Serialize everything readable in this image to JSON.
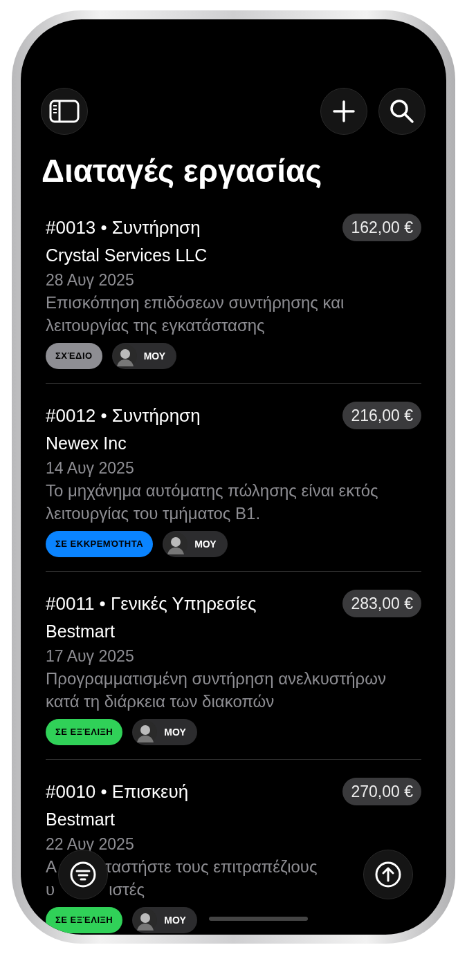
{
  "title": "Διαταγές εργασίας",
  "orders": [
    {
      "heading": "#0013 • Συντήρηση",
      "amount": "162,00 €",
      "customer": "Crystal Services LLC",
      "date": "28 Αυγ 2025",
      "description": "Επισκόπηση επιδόσεων συντήρησης και λειτουργίας της εγκατάστασης",
      "status": {
        "label": "ΣΧΈΔΙΟ",
        "color": "#8e8e93"
      },
      "assignee": "ΜΟΥ"
    },
    {
      "heading": "#0012 • Συντήρηση",
      "amount": "216,00 €",
      "customer": "Newex Inc",
      "date": "14 Αυγ 2025",
      "description": "Το μηχάνημα αυτόματης πώλησης είναι εκτός λειτουργίας του τμήματος Β1.",
      "status": {
        "label": "ΣΕ ΕΚΚΡΕΜΌΤΗΤΑ",
        "color": "#0a84ff"
      },
      "assignee": "ΜΟΥ"
    },
    {
      "heading": "#0011 • Γενικές Υπηρεσίες",
      "amount": "283,00 €",
      "customer": "Bestmart",
      "date": "17 Αυγ 2025",
      "description": "Προγραμματισμένη συντήρηση ανελκυστήρων κατά τη διάρκεια των διακοπών",
      "status": {
        "label": "ΣΕ ΕΞΈΛΙΞΗ",
        "color": "#30d158"
      },
      "assignee": "ΜΟΥ"
    },
    {
      "heading": "#0010 • Επισκευή",
      "amount": "270,00 €",
      "customer": "Bestmart",
      "date": "22 Αυγ 2025",
      "description": [
        "Α",
        "ταστήστε τους επιτραπέζιους",
        "υ",
        "ιστές"
      ],
      "status": {
        "label": "ΣΕ ΕΞΈΛΙΞΗ",
        "color": "#30d158"
      },
      "assignee": "ΜΟΥ"
    }
  ]
}
